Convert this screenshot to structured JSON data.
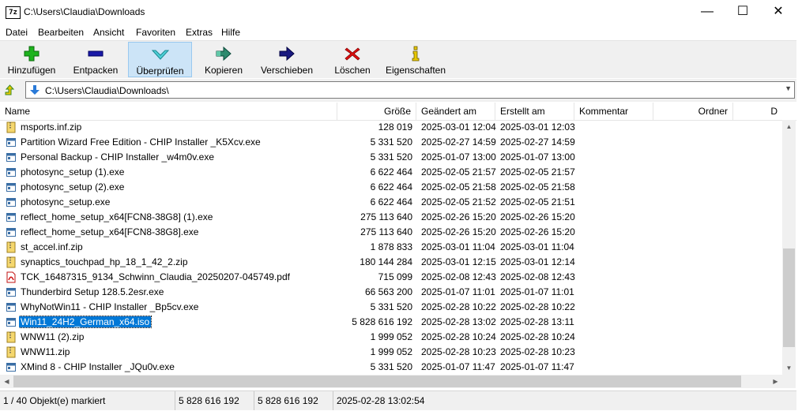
{
  "window": {
    "title": "C:\\Users\\Claudia\\Downloads",
    "app_icon_text": "7z",
    "minimize": "—",
    "maximize": "☐",
    "close": "✕"
  },
  "menu": [
    "Datei",
    "Bearbeiten",
    "Ansicht",
    "Favoriten",
    "Extras",
    "Hilfe"
  ],
  "toolbar": [
    {
      "label": "Hinzufügen",
      "icon": "add-icon",
      "color": "#1db31d"
    },
    {
      "label": "Entpacken",
      "icon": "extract-icon",
      "color": "#1a1aa8"
    },
    {
      "label": "Überprüfen",
      "icon": "test-icon",
      "color": "#4fd0d8"
    },
    {
      "label": "Kopieren",
      "icon": "copy-icon",
      "color": "#2e8a6e"
    },
    {
      "label": "Verschieben",
      "icon": "move-icon",
      "color": "#1a1a80"
    },
    {
      "label": "Löschen",
      "icon": "delete-icon",
      "color": "#e01010"
    },
    {
      "label": "Eigenschaften",
      "icon": "info-icon",
      "color": "#e8c800"
    }
  ],
  "address": {
    "path": "C:\\Users\\Claudia\\Downloads\\"
  },
  "columns": [
    "Name",
    "Größe",
    "Geändert am",
    "Erstellt am",
    "Kommentar",
    "Ordner",
    "D"
  ],
  "files": [
    {
      "name": "msports.inf.zip",
      "size": "128 019",
      "modified": "2025-03-01 12:04",
      "created": "2025-03-01 12:03",
      "type": "zip"
    },
    {
      "name": "Partition Wizard Free Edition - CHIP Installer _K5Xcv.exe",
      "size": "5 331 520",
      "modified": "2025-02-27 14:59",
      "created": "2025-02-27 14:59",
      "type": "exe"
    },
    {
      "name": "Personal Backup - CHIP Installer _w4m0v.exe",
      "size": "5 331 520",
      "modified": "2025-01-07 13:00",
      "created": "2025-01-07 13:00",
      "type": "exe"
    },
    {
      "name": "photosync_setup (1).exe",
      "size": "6 622 464",
      "modified": "2025-02-05 21:57",
      "created": "2025-02-05 21:57",
      "type": "exe"
    },
    {
      "name": "photosync_setup (2).exe",
      "size": "6 622 464",
      "modified": "2025-02-05 21:58",
      "created": "2025-02-05 21:58",
      "type": "exe"
    },
    {
      "name": "photosync_setup.exe",
      "size": "6 622 464",
      "modified": "2025-02-05 21:52",
      "created": "2025-02-05 21:51",
      "type": "exe"
    },
    {
      "name": "reflect_home_setup_x64[FCN8-38G8] (1).exe",
      "size": "275 113 640",
      "modified": "2025-02-26 15:20",
      "created": "2025-02-26 15:20",
      "type": "exe"
    },
    {
      "name": "reflect_home_setup_x64[FCN8-38G8].exe",
      "size": "275 113 640",
      "modified": "2025-02-26 15:20",
      "created": "2025-02-26 15:20",
      "type": "exe"
    },
    {
      "name": "st_accel.inf.zip",
      "size": "1 878 833",
      "modified": "2025-03-01 11:04",
      "created": "2025-03-01 11:04",
      "type": "zip"
    },
    {
      "name": "synaptics_touchpad_hp_18_1_42_2.zip",
      "size": "180 144 284",
      "modified": "2025-03-01 12:15",
      "created": "2025-03-01 12:14",
      "type": "zip"
    },
    {
      "name": "TCK_16487315_9134_Schwinn_Claudia_20250207-045749.pdf",
      "size": "715 099",
      "modified": "2025-02-08 12:43",
      "created": "2025-02-08 12:43",
      "type": "pdf"
    },
    {
      "name": "Thunderbird Setup 128.5.2esr.exe",
      "size": "66 563 200",
      "modified": "2025-01-07 11:01",
      "created": "2025-01-07 11:01",
      "type": "exe"
    },
    {
      "name": "WhyNotWin11 - CHIP Installer _Bp5cv.exe",
      "size": "5 331 520",
      "modified": "2025-02-28 10:22",
      "created": "2025-02-28 10:22",
      "type": "exe"
    },
    {
      "name": "Win11_24H2_German_x64.iso",
      "size": "5 828 616 192",
      "modified": "2025-02-28 13:02",
      "created": "2025-02-28 13:11",
      "type": "iso",
      "selected": true
    },
    {
      "name": "WNW11 (2).zip",
      "size": "1 999 052",
      "modified": "2025-02-28 10:24",
      "created": "2025-02-28 10:24",
      "type": "zip"
    },
    {
      "name": "WNW11.zip",
      "size": "1 999 052",
      "modified": "2025-02-28 10:23",
      "created": "2025-02-28 10:23",
      "type": "zip"
    },
    {
      "name": "XMind 8 - CHIP Installer _JQu0v.exe",
      "size": "5 331 520",
      "modified": "2025-01-07 11:47",
      "created": "2025-01-07 11:47",
      "type": "exe"
    }
  ],
  "status": {
    "selection": "1 / 40 Objekt(e) markiert",
    "size": "5 828 616 192",
    "packed": "5 828 616 192",
    "date": "2025-02-28 13:02:54"
  }
}
